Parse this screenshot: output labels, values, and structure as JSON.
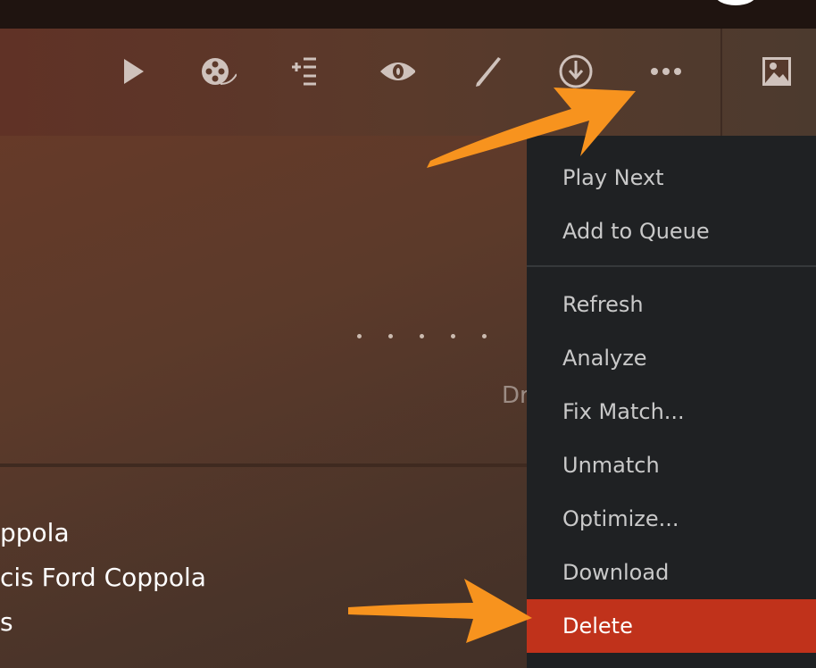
{
  "toolbar": {
    "icons": [
      "play-icon",
      "trailer-reel-icon",
      "add-to-playlist-icon",
      "watched-eye-icon",
      "edit-pencil-icon",
      "download-icon",
      "more-ellipsis-icon",
      "poster-image-icon"
    ]
  },
  "content": {
    "partial_label": "Dr",
    "credits": [
      "ppola",
      "cis Ford Coppola",
      "s"
    ]
  },
  "menu": {
    "items": [
      {
        "label": "Play Next"
      },
      {
        "label": "Add to Queue"
      },
      {
        "label": "Refresh"
      },
      {
        "label": "Analyze"
      },
      {
        "label": "Fix Match..."
      },
      {
        "label": "Unmatch"
      },
      {
        "label": "Optimize..."
      },
      {
        "label": "Download"
      },
      {
        "label": "Delete",
        "highlighted": true
      }
    ]
  },
  "colors": {
    "annotation_arrow": "#f7931e",
    "delete_highlight": "#c0321b",
    "menu_bg": "#1f2123"
  }
}
